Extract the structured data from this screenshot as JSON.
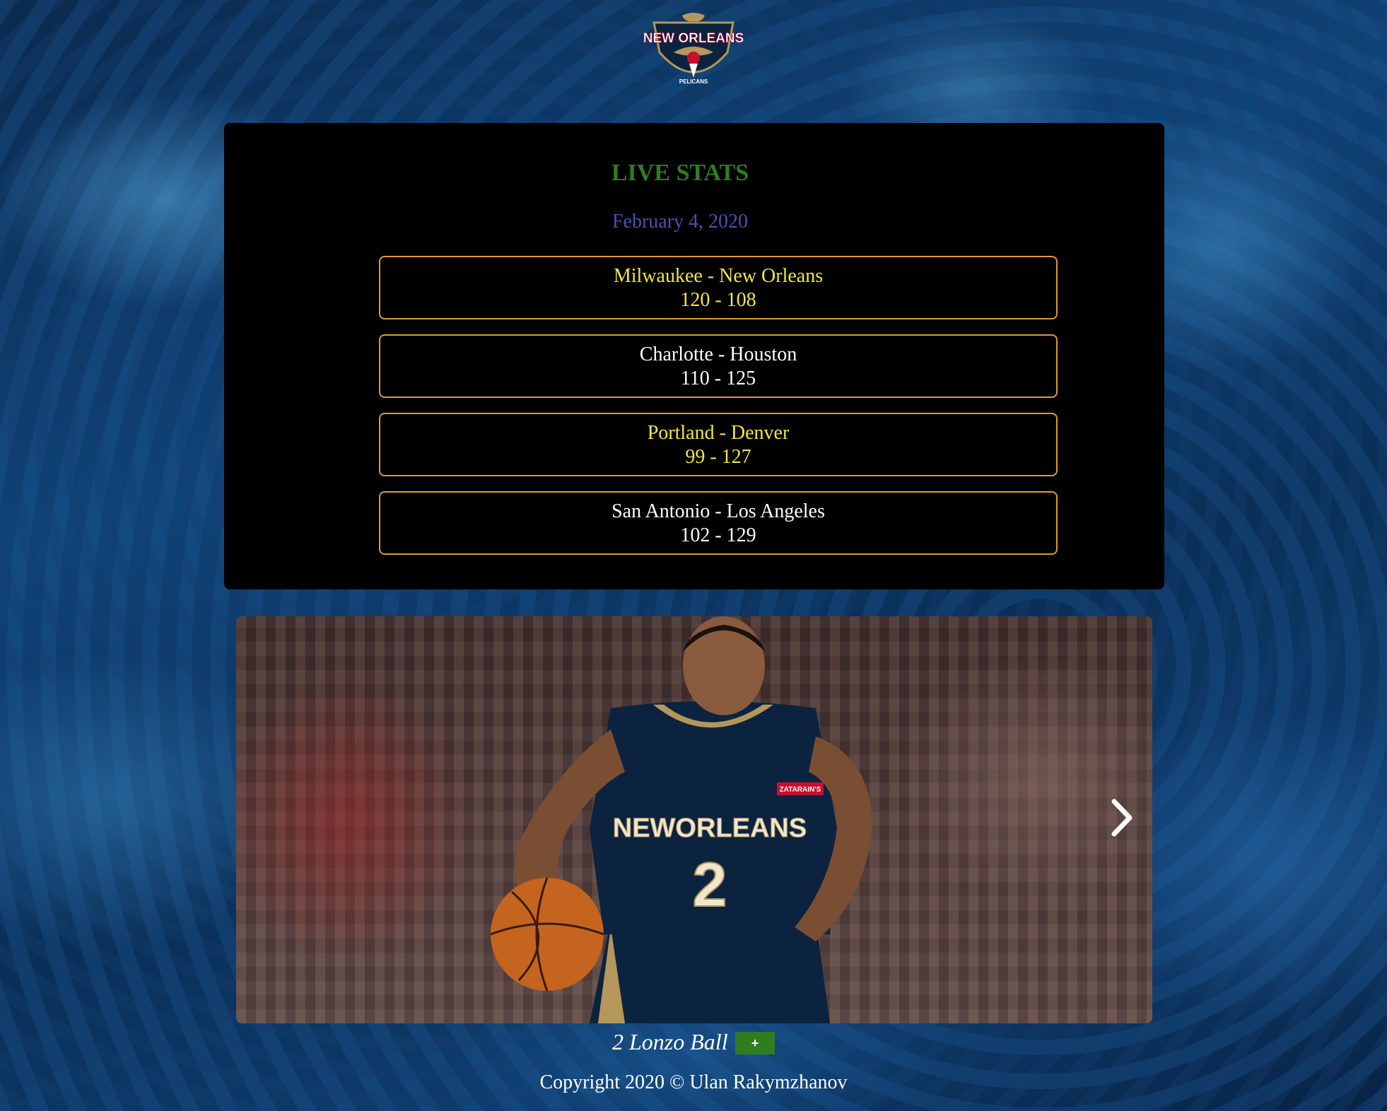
{
  "header": {
    "logo_text": "NEW ORLEANS",
    "logo_subtext": "PELICANS"
  },
  "stats": {
    "title": "LIVE STATS",
    "date": "February 4, 2020",
    "games": [
      {
        "teams": "Milwaukee - New Orleans",
        "score": "120 - 108",
        "color": "#f3e73c"
      },
      {
        "teams": "Charlotte - Houston",
        "score": "110 - 125",
        "color": "#ffffff"
      },
      {
        "teams": "Portland - Denver",
        "score": "99 - 127",
        "color": "#f3e73c"
      },
      {
        "teams": "San Antonio - Los Angeles",
        "score": "102 - 129",
        "color": "#ffffff"
      }
    ]
  },
  "carousel": {
    "jersey_text": "NEWORLEANS",
    "jersey_number": "2",
    "sponsor_patch": "ZATARAIN'S",
    "caption": "2 Lonzo Ball",
    "add_label": "+",
    "next_icon": "chevron-right-icon"
  },
  "footer": {
    "copyright": "Copyright 2020 © Ulan Rakymzhanov"
  },
  "colors": {
    "title_green": "#2f7d1f",
    "date_blue": "#4a52b0",
    "card_border": "#e09a2e",
    "panel_bg": "#000000"
  }
}
